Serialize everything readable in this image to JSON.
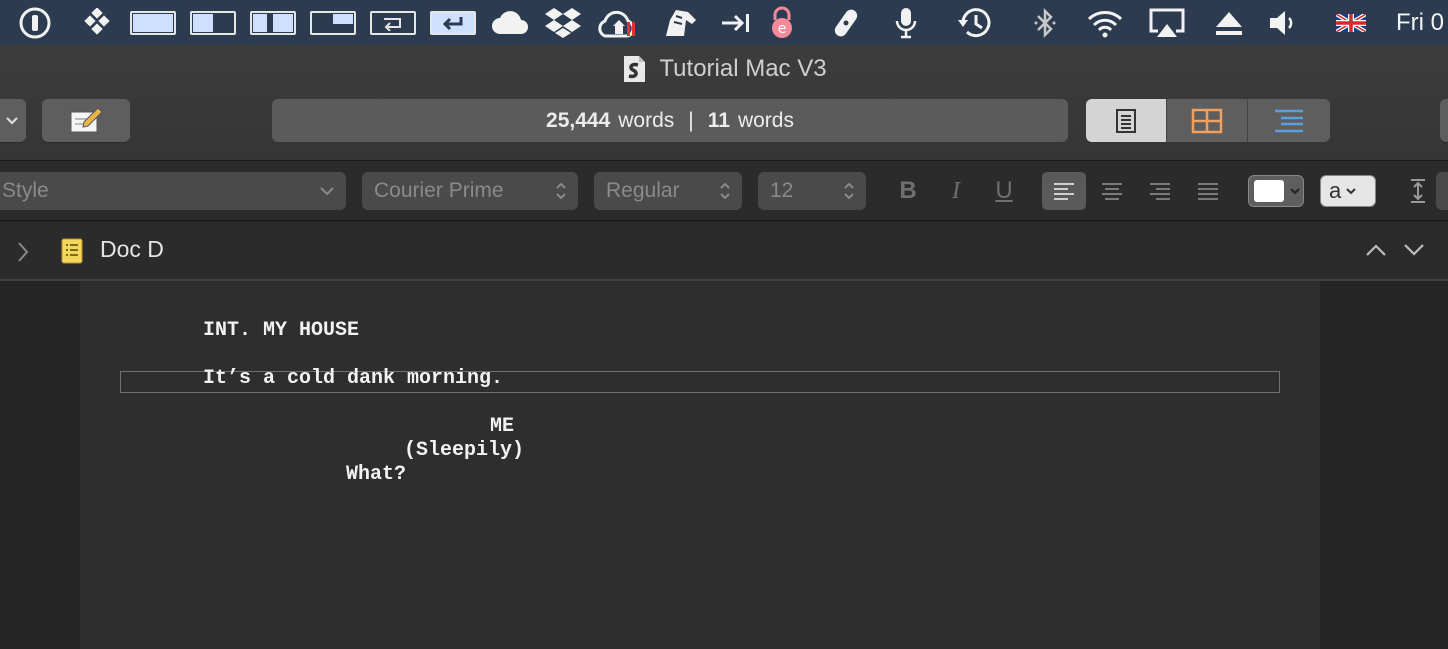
{
  "menubar": {
    "icons": [
      "1password-icon",
      "dropbox-grid-icon",
      "layout-full-icon",
      "layout-left-icon",
      "layout-split-icon",
      "layout-corner-icon",
      "loop-icon",
      "return-icon",
      "cloud-icon",
      "dropbox-icon",
      "home-cloud-icon",
      "horse-icon",
      "arrow-to-bar-icon",
      "lock-e-icon",
      "bandage-icon",
      "microphone-icon",
      "time-machine-icon",
      "bluetooth-icon",
      "wifi-icon",
      "airplay-icon",
      "eject-icon",
      "volume-icon",
      "uk-flag-icon"
    ],
    "clock": "Fri 0"
  },
  "window": {
    "title": "Tutorial Mac V3"
  },
  "toolbar": {
    "word_total": "25,444",
    "word_total_unit": "words",
    "separator": "|",
    "word_selection": "11",
    "word_selection_unit": "words"
  },
  "formatbar": {
    "style": "Style",
    "font": "Courier Prime",
    "weight": "Regular",
    "size": "12",
    "bold": "B",
    "italic": "I",
    "underline": "U",
    "text_color_label": "a"
  },
  "header": {
    "doc_title": "Doc D"
  },
  "script": {
    "scene_heading": "INT. MY HOUSE",
    "action": "It’s a cold dank morning.",
    "character": "ME",
    "parenthetical": "(Sleepily)",
    "dialogue": "What?"
  },
  "colors": {
    "menubar_bg": "#2c3b50",
    "toolbar_bg": "#3a3a3a",
    "editor_page": "#2e2e2e",
    "accent_orange": "#f0a060",
    "accent_blue": "#5aa0e0"
  }
}
